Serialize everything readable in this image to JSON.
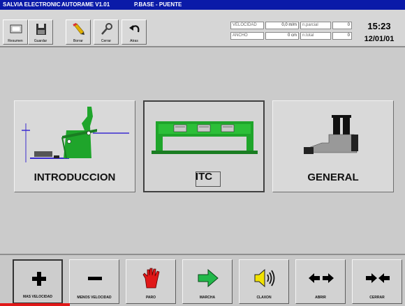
{
  "titlebar": {
    "app": "SALVIA ELECTRONIC",
    "version": "AUTORAME V1.01",
    "screen": "P.BASE - PUENTE"
  },
  "toolbar": {
    "buttons": [
      {
        "label": "Resumen",
        "icon": "monitor-icon"
      },
      {
        "label": "Guardar",
        "icon": "floppy-disk-icon"
      },
      {
        "label": "Borrar",
        "icon": "pencil-eraser-icon"
      },
      {
        "label": "Cerrar",
        "icon": "wrench-icon"
      },
      {
        "label": "Atras",
        "icon": "undo-arrow-icon"
      }
    ]
  },
  "status": {
    "velocidad_label": "VELOCIDAD",
    "velocidad_value": "0,0 m/m",
    "parcial_label": "n.parcial",
    "parcial_value": "0",
    "ancho_label": "ANCHO",
    "ancho_value": "0 cm",
    "total_label": "n.total",
    "total_value": "0",
    "time": "15:23",
    "date": "12/01/01"
  },
  "panels": [
    {
      "label": "INTRODUCCION",
      "icon": "introduccion-machine-icon"
    },
    {
      "label": "ITC",
      "icon": "itc-bridge-icon",
      "selected": true
    },
    {
      "label": "GENERAL",
      "icon": "general-machine-icon"
    }
  ],
  "bottom": {
    "buttons": [
      {
        "label": "MAS VELOCIDAD",
        "icon": "plus-icon"
      },
      {
        "label": "MENOS VELOCIDAD",
        "icon": "minus-icon"
      },
      {
        "label": "PARO",
        "icon": "red-stop-hand-icon"
      },
      {
        "label": "MARCHA",
        "icon": "green-arrow-right-icon"
      },
      {
        "label": "CLAXON",
        "icon": "speaker-horn-icon"
      },
      {
        "label": "ABRIR",
        "icon": "arrows-apart-icon"
      },
      {
        "label": "CERRAR",
        "icon": "arrows-together-icon"
      }
    ]
  },
  "colors": {
    "titlebar": "#0a1aa8",
    "machine_green": "#1fa52b",
    "stop_red": "#e01818",
    "arrow_green": "#22b84a",
    "speaker_yellow": "#f2e200"
  }
}
